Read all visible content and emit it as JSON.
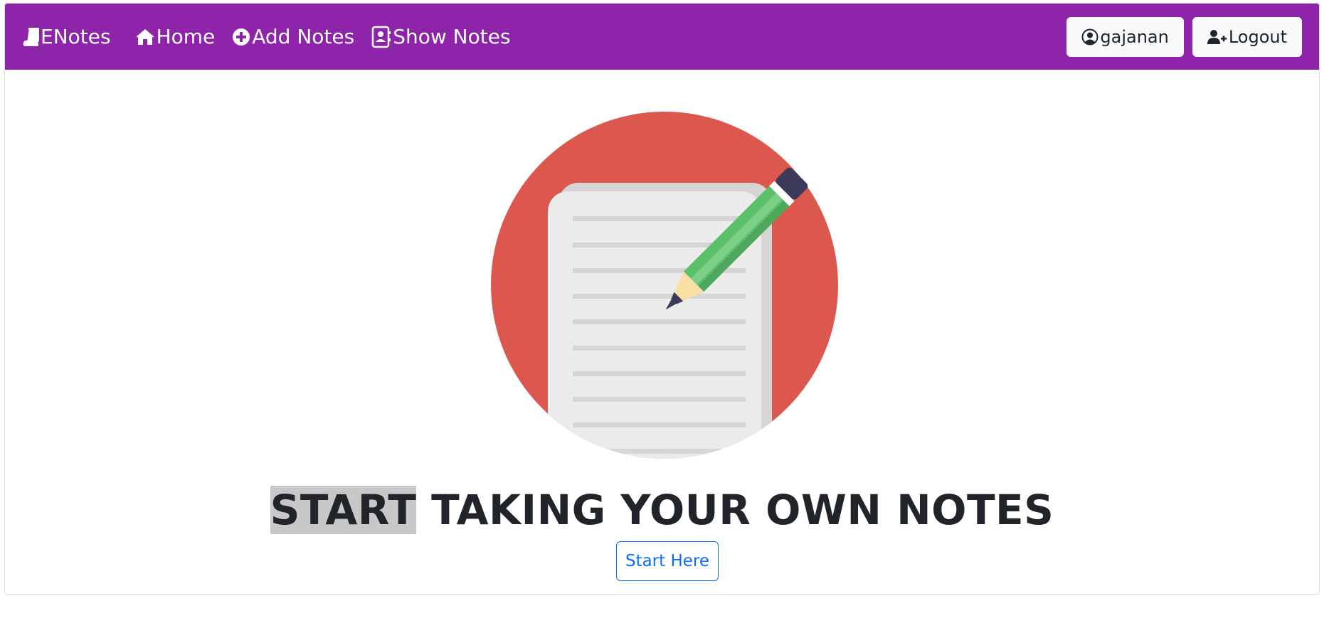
{
  "navbar": {
    "brand_label": "ENotes",
    "links": [
      {
        "label": "Home",
        "icon": "home-icon"
      },
      {
        "label": "Add Notes",
        "icon": "plus-circle-icon"
      },
      {
        "label": "Show Notes",
        "icon": "address-book-icon"
      }
    ],
    "user_button_label": "gajanan",
    "logout_button_label": "Logout",
    "background_color": "#8e24aa"
  },
  "hero": {
    "illustration": "notepad-pencil-illustration",
    "headline_highlighted": "START",
    "headline_rest": " TAKING YOUR OWN NOTES",
    "cta_label": "Start Here"
  },
  "colors": {
    "accent": "#8e24aa",
    "primary_button": "#0d6efd",
    "circle": "#dc574e",
    "pencil": "#5cbf6b"
  }
}
